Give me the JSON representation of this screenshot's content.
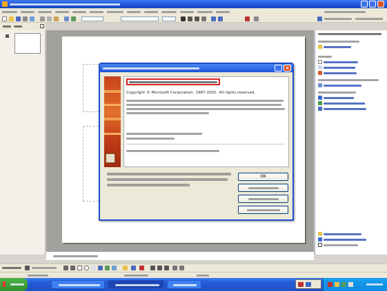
{
  "dialog": {
    "copyright": "Copyright © Microsoft Corporation. 1987-2001. All rights reserved.",
    "ok_label": "OK"
  },
  "colors": {
    "title_blue": "#1f55d9",
    "banner_orange": "#e2702b",
    "highlight_red": "#d62020",
    "start_green": "#2f8f2a",
    "tray_blue": "#0d8ae0"
  },
  "icons": {
    "window_controls": [
      "minimize-icon",
      "maximize-icon",
      "close-icon"
    ],
    "task_pane": [
      "new-presentation-icon",
      "template-icon",
      "help-icon"
    ]
  }
}
